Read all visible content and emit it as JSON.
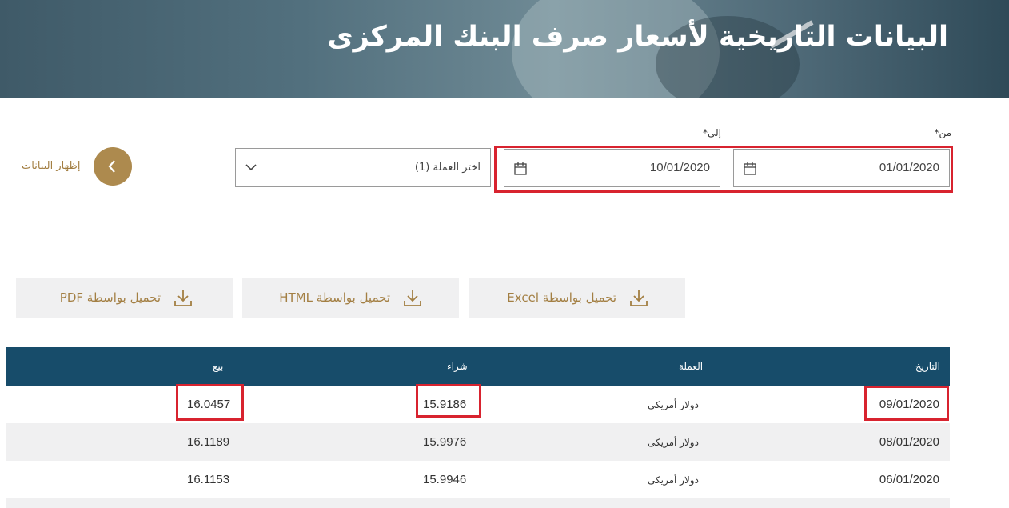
{
  "header": {
    "title": "البيانات التاريخية لأسعار صرف البنك المركزى"
  },
  "filters": {
    "from_label": "من*",
    "to_label": "إلى*",
    "from_value": "01/01/2020",
    "to_value": "10/01/2020",
    "currency_select_value": "اختر العملة (1)",
    "show_data_label": "إظهار البيانات"
  },
  "downloads": {
    "excel": "تحميل بواسطة Excel",
    "html": "تحميل بواسطة HTML",
    "pdf": "تحميل بواسطة PDF"
  },
  "table": {
    "columns": {
      "date": "التاريخ",
      "currency": "العملة",
      "buy": "شراء",
      "sell": "بيع"
    },
    "rows": [
      {
        "date": "09/01/2020",
        "currency": "دولار أمريكى",
        "buy": "15.9186",
        "sell": "16.0457"
      },
      {
        "date": "08/01/2020",
        "currency": "دولار أمريكى",
        "buy": "15.9976",
        "sell": "16.1189"
      },
      {
        "date": "06/01/2020",
        "currency": "دولار أمريكى",
        "buy": "15.9946",
        "sell": "16.1153"
      }
    ]
  },
  "colors": {
    "accent": "#ad8a4e",
    "table_header": "#174c6a",
    "highlight": "#d8232f"
  },
  "icons": {
    "calendar": "calendar-icon",
    "chevron": "chevron-down-icon",
    "arrow": "chevron-right-icon",
    "download": "download-icon"
  }
}
